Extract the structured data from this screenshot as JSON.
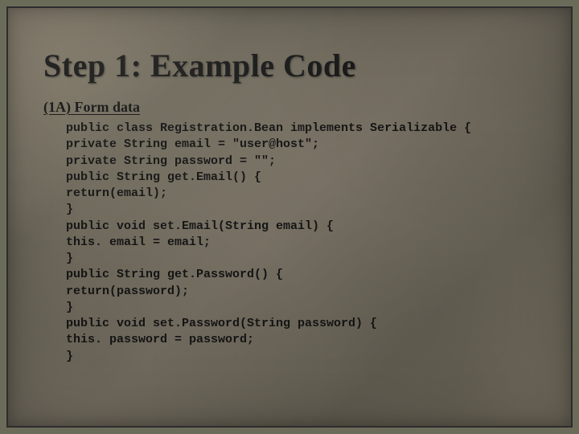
{
  "slide": {
    "title": "Step 1: Example Code",
    "subtitle": "(1A) Form data",
    "code": "public class Registration.Bean implements Serializable {\nprivate String email = \"user@host\";\nprivate String password = \"\";\npublic String get.Email() {\nreturn(email);\n}\npublic void set.Email(String email) {\nthis. email = email;\n}\npublic String get.Password() {\nreturn(password);\n}\npublic void set.Password(String password) {\nthis. password = password;\n}"
  }
}
